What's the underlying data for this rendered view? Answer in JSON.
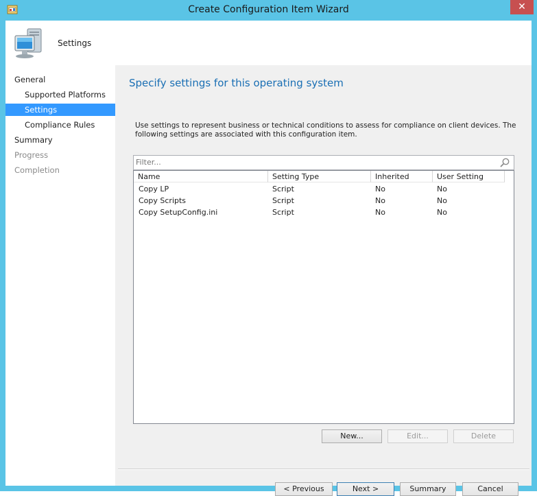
{
  "window": {
    "title": "Create Configuration Item Wizard",
    "close_glyph": "✕"
  },
  "header": {
    "label": "Settings",
    "icon": "computer-icon"
  },
  "nav": {
    "items": [
      {
        "label": "General",
        "state": "normal"
      },
      {
        "label": "Supported Platforms",
        "state": "normal"
      },
      {
        "label": "Settings",
        "state": "selected"
      },
      {
        "label": "Compliance Rules",
        "state": "normal"
      },
      {
        "label": "Summary",
        "state": "normal"
      },
      {
        "label": "Progress",
        "state": "disabled"
      },
      {
        "label": "Completion",
        "state": "disabled"
      }
    ]
  },
  "main": {
    "title": "Specify settings for this operating system",
    "description": "Use settings to represent business or technical conditions to assess for compliance on client devices. The following settings are associated with this configuration item.",
    "filter": {
      "placeholder": "Filter..."
    },
    "table": {
      "columns": [
        "Name",
        "Setting Type",
        "Inherited",
        "User Setting"
      ],
      "rows": [
        [
          "Copy LP",
          "Script",
          "No",
          "No"
        ],
        [
          "Copy Scripts",
          "Script",
          "No",
          "No"
        ],
        [
          "Copy SetupConfig.ini",
          "Script",
          "No",
          "No"
        ]
      ]
    },
    "buttons": {
      "new": "New...",
      "edit": "Edit...",
      "delete": "Delete"
    }
  },
  "footer": {
    "previous": "< Previous",
    "next": "Next >",
    "summary": "Summary",
    "cancel": "Cancel"
  },
  "colors": {
    "title_blue": "#1a6fb4",
    "selection": "#3399ff",
    "frame": "#5ac4e6",
    "close": "#c75050"
  }
}
